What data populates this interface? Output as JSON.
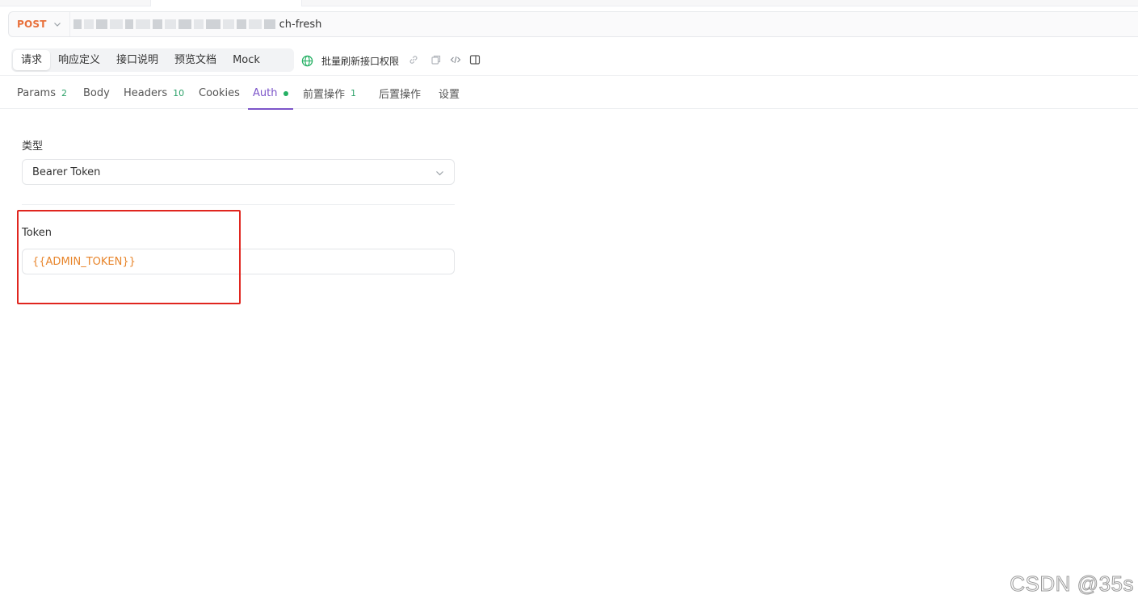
{
  "url_bar": {
    "method": "POST",
    "url_suffix": "ch-fresh"
  },
  "mode_tabs": [
    {
      "label": "请求",
      "active": true
    },
    {
      "label": "响应定义",
      "active": false
    },
    {
      "label": "接口说明",
      "active": false
    },
    {
      "label": "预览文档",
      "active": false
    },
    {
      "label": "Mock",
      "active": false
    }
  ],
  "bulk_refresh_label": "批量刷新接口权限",
  "icons": [
    "chevron-down-icon",
    "globe-icon",
    "link-icon",
    "copy-icon",
    "code-icon",
    "split-panel-icon"
  ],
  "sub_tabs": [
    {
      "label": "Params",
      "count": "2"
    },
    {
      "label": "Body",
      "count": ""
    },
    {
      "label": "Headers",
      "count": "10"
    },
    {
      "label": "Cookies",
      "count": ""
    },
    {
      "label": "Auth",
      "count": "",
      "active": true
    },
    {
      "label": "前置操作",
      "count": "1"
    },
    {
      "label": "后置操作",
      "count": ""
    },
    {
      "label": "设置",
      "count": ""
    }
  ],
  "auth": {
    "type_label": "类型",
    "type_value": "Bearer Token",
    "token_label": "Token",
    "token_value": "{{ADMIN_TOKEN}}"
  },
  "colors": {
    "method": "#e8703b",
    "accent": "#7c55c9",
    "count": "#2ea26a",
    "variable": "#e8852b",
    "highlight_box": "#e0261f"
  },
  "watermark": "CSDN @35s"
}
